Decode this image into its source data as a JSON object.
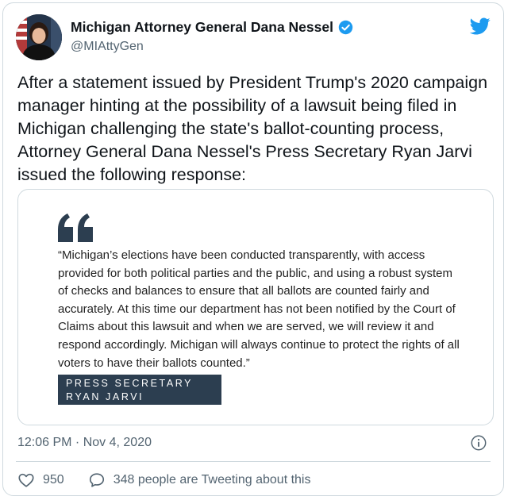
{
  "author": {
    "name": "Michigan Attorney General Dana Nessel",
    "handle": "@MIAttyGen",
    "verified": true
  },
  "tweet": {
    "text": "After a statement issued by President Trump's 2020 campaign manager hinting at the possibility of a lawsuit being filed in Michigan challenging the state's ballot-counting process, Attorney General Dana Nessel's Press Secretary Ryan Jarvi issued the following response:",
    "timestamp": "12:06 PM · Nov 4, 2020"
  },
  "embedded_statement": {
    "quote": "“Michigan’s elections have been conducted transparently, with access provided for both political parties and the public, and using a robust system of checks and balances to ensure that all ballots are counted fairly and accurately. At this time our department has not been notified by the Court of Claims about this lawsuit and when we are served, we will review it and respond accordingly.  Michigan will always continue to protect the rights of all voters to have their ballots counted.”",
    "attribution_title": "PRESS SECRETARY",
    "attribution_name": "RYAN JARVI"
  },
  "actions": {
    "like_count": "950",
    "conversation_label": "348 people are Tweeting about this"
  },
  "colors": {
    "brand_blue": "#1d9bf0",
    "text_primary": "#0f1419",
    "text_secondary": "#536471",
    "quote_accent": "#2c3e50"
  }
}
